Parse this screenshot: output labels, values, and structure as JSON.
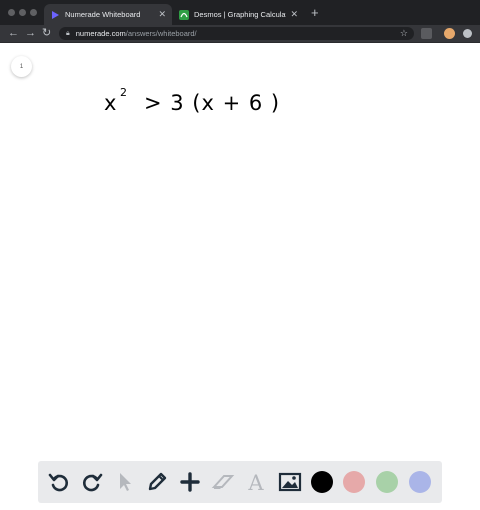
{
  "browser": {
    "tabs": [
      {
        "label": "Numerade Whiteboard",
        "active": true,
        "favicon": "numerade-icon"
      },
      {
        "label": "Desmos | Graphing Calculator",
        "active": false,
        "favicon": "desmos-icon"
      }
    ],
    "new_tab_symbol": "+",
    "url_host": "numerade.com",
    "url_path": "/answers/whiteboard/"
  },
  "whiteboard": {
    "page_number": "1",
    "handwriting": {
      "base": "x",
      "exponent": "2",
      "rest": "> 3 (x + 6 )"
    }
  },
  "drawing_toolbar": {
    "tools": [
      "undo-icon",
      "redo-icon",
      "pointer-icon",
      "pen-icon",
      "add-icon",
      "eraser-icon",
      "text-icon",
      "image-icon"
    ],
    "colors": [
      "#000000",
      "#e6a9a9",
      "#a8d1a8",
      "#aab5e8"
    ],
    "selected_color": "#000000"
  }
}
